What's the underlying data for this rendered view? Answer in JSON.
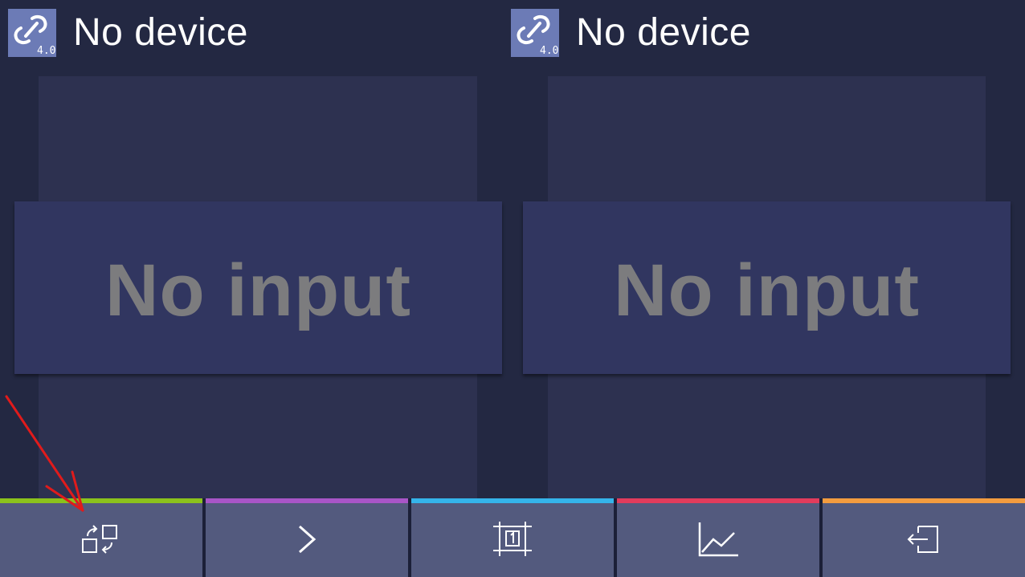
{
  "panels": {
    "left": {
      "device_label": "No device",
      "status_text": "No input",
      "app_icon": {
        "name": "bluetooth-link-icon",
        "version_text": "4.0"
      }
    },
    "right": {
      "device_label": "No device",
      "status_text": "No input",
      "app_icon": {
        "name": "bluetooth-link-icon",
        "version_text": "4.0"
      }
    }
  },
  "toolbar": {
    "tabs": [
      {
        "icon": "swap-panels-icon",
        "color": "#8bc21c"
      },
      {
        "icon": "chevron-right-icon",
        "color": "#a855c7"
      },
      {
        "icon": "single-view-icon",
        "color": "#35b4ea"
      },
      {
        "icon": "line-chart-icon",
        "color": "#e23c5c"
      },
      {
        "icon": "exit-icon",
        "color": "#f39c3f"
      }
    ]
  },
  "colors": {
    "background": "#232842",
    "column": "#2d3150",
    "card": "#313660",
    "tab_background": "#535a7e",
    "status_text": "#7c7c7e",
    "annotation_arrow": "#e01b1b"
  }
}
